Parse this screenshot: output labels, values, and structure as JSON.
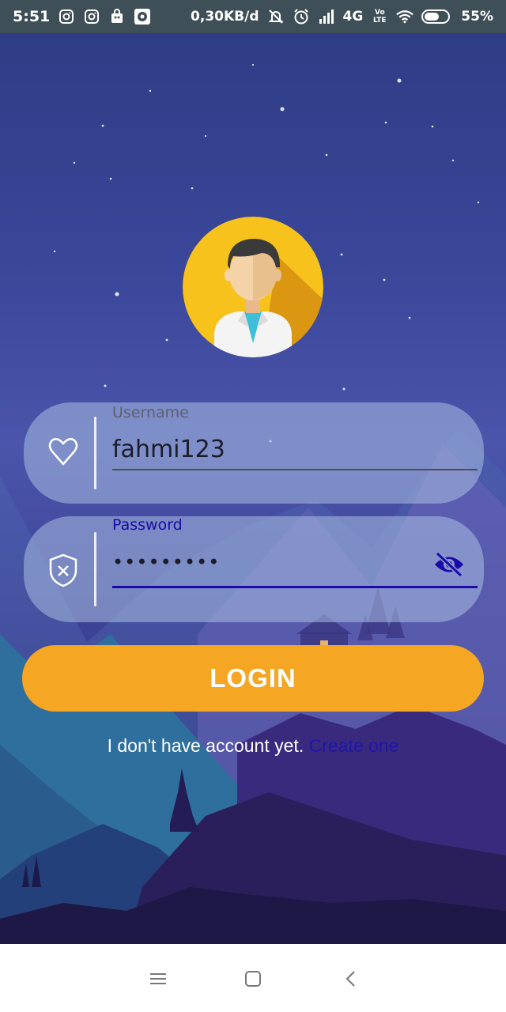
{
  "status_bar": {
    "time": "5:51",
    "data_speed": "0,30KB/d",
    "network": "4G",
    "volte": "Vo LTE",
    "battery": "55%",
    "icons": [
      "instagram-icon",
      "instagram-icon",
      "shopping-bag-icon",
      "music-icon",
      "mute-icon",
      "alarm-icon",
      "signal-icon",
      "wifi-icon",
      "battery-icon"
    ]
  },
  "login_form": {
    "username": {
      "label": "Username",
      "value": "fahmi123",
      "icon": "heart-icon"
    },
    "password": {
      "label": "Password",
      "value": "•••••••••",
      "icon": "shield-icon",
      "toggle_icon": "eye-off-icon"
    },
    "login_button": "LOGIN",
    "signup_prompt": "I don't have account yet.",
    "signup_link": "Create one"
  },
  "nav_bar": {
    "buttons": [
      "menu-icon",
      "home-icon",
      "back-icon"
    ]
  },
  "colors": {
    "accent": "#f5a623",
    "link": "#1f16a8",
    "password_active": "#1a0aa8",
    "status_bar": "#3f4f58",
    "background_top": "#2f3d86"
  }
}
